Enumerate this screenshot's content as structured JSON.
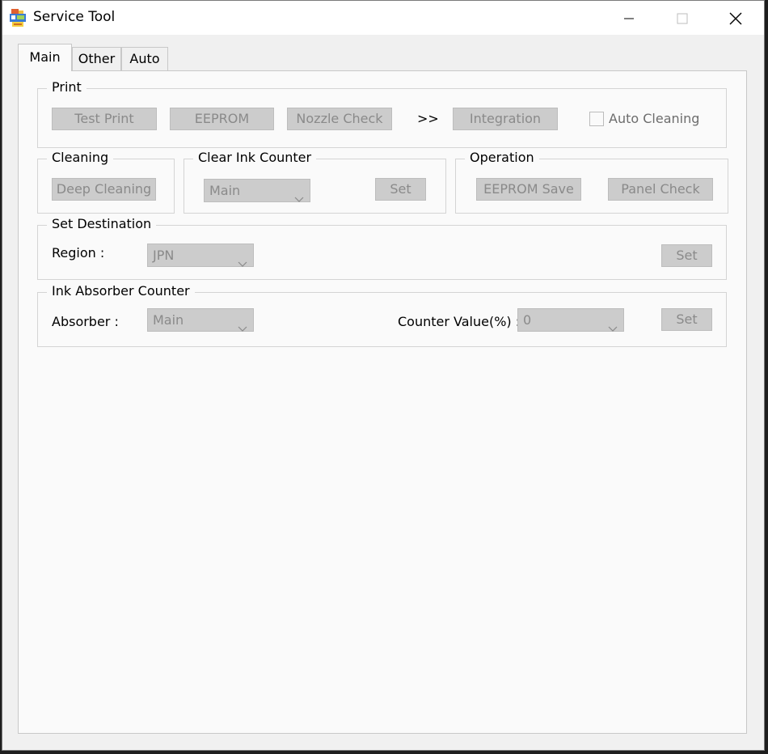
{
  "window": {
    "title": "Service Tool",
    "icon": "printer-app-icon",
    "controls": {
      "minimize": "minimize-icon",
      "maximize": "maximize-icon",
      "close": "close-icon"
    }
  },
  "tabs": [
    {
      "label": "Main",
      "active": true
    },
    {
      "label": "Other",
      "active": false
    },
    {
      "label": "Auto",
      "active": false
    }
  ],
  "print": {
    "legend": "Print",
    "test_print": "Test Print",
    "eeprom": "EEPROM",
    "nozzle_check": "Nozzle Check",
    "arrows": ">>",
    "integration": "Integration",
    "auto_cleaning": "Auto Cleaning",
    "auto_cleaning_checked": false
  },
  "cleaning": {
    "legend": "Cleaning",
    "deep_cleaning": "Deep Cleaning"
  },
  "clear_ink_counter": {
    "legend": "Clear Ink Counter",
    "selected": "Main",
    "set": "Set"
  },
  "operation": {
    "legend": "Operation",
    "eeprom_save": "EEPROM Save",
    "panel_check": "Panel Check"
  },
  "set_destination": {
    "legend": "Set Destination",
    "region_label": "Region :",
    "region_value": "JPN",
    "set": "Set"
  },
  "ink_absorber_counter": {
    "legend": "Ink Absorber Counter",
    "absorber_label": "Absorber :",
    "absorber_value": "Main",
    "counter_label": "Counter Value(%) :",
    "counter_value": "0",
    "set": "Set"
  },
  "colors": {
    "disabled_button": "#cccccc",
    "disabled_text": "#8a8a8a",
    "panel_bg": "#fafafa",
    "window_bg": "#f0f0f0"
  }
}
